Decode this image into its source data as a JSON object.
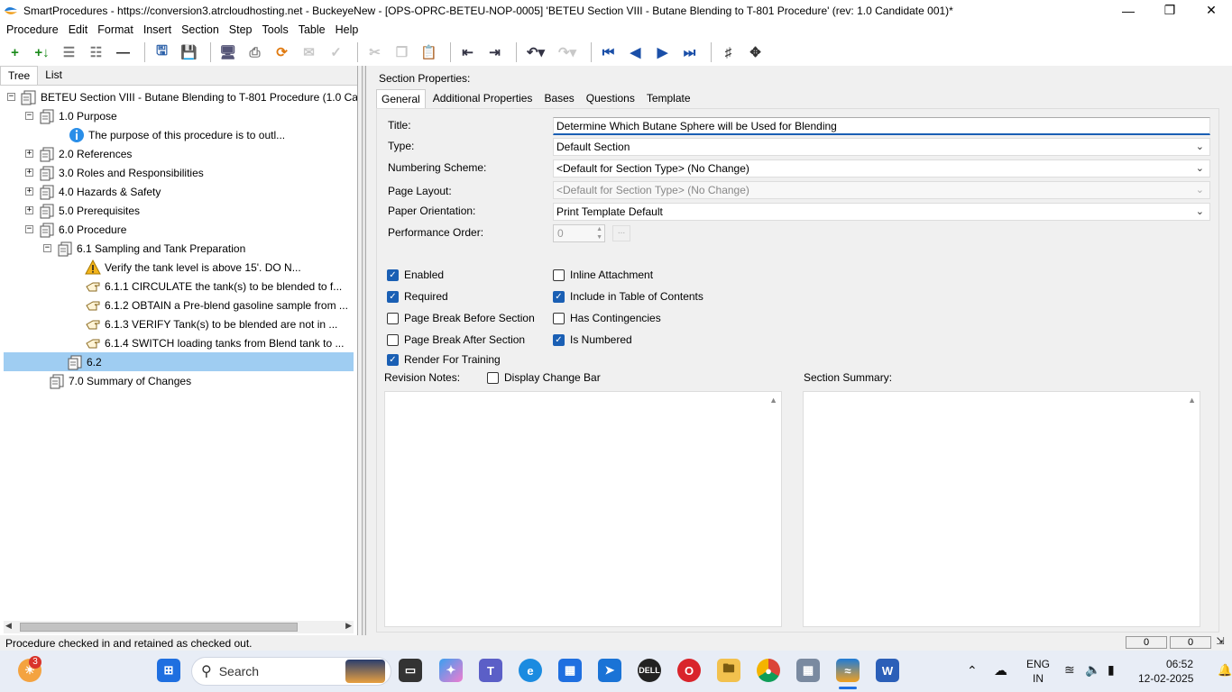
{
  "window": {
    "title": "SmartProcedures - https://conversion3.atrcloudhosting.net - BuckeyeNew - [OPS-OPRC-BETEU-NOP-0005] 'BETEU Section VIII - Butane Blending to T-801 Procedure' (rev: 1.0 Candidate 001)*",
    "minimize": "—",
    "maximize": "❐",
    "close": "✕"
  },
  "menu": [
    "Procedure",
    "Edit",
    "Format",
    "Insert",
    "Section",
    "Step",
    "Tools",
    "Table",
    "Help"
  ],
  "left_panel": {
    "tabs": [
      "Tree",
      "List"
    ],
    "tree": [
      {
        "label": "BETEU Section VIII - Butane Blending to T-801 Procedure (1.0 Ca...",
        "expander": "−",
        "icon": "procedure-icon"
      },
      {
        "label": "1.0 Purpose",
        "expander": "−",
        "icon": "section-icon"
      },
      {
        "label": "The purpose of this procedure is to outl...",
        "expander": "",
        "icon": "info-icon"
      },
      {
        "label": "2.0 References",
        "expander": "+",
        "icon": "section-icon"
      },
      {
        "label": "3.0 Roles and Responsibilities",
        "expander": "+",
        "icon": "section-icon"
      },
      {
        "label": "4.0 Hazards & Safety",
        "expander": "+",
        "icon": "section-icon"
      },
      {
        "label": "5.0 Prerequisites",
        "expander": "+",
        "icon": "section-icon"
      },
      {
        "label": "6.0 Procedure",
        "expander": "−",
        "icon": "section-icon"
      },
      {
        "label": "6.1 Sampling and Tank Preparation",
        "expander": "−",
        "icon": "section-icon"
      },
      {
        "label": "Verify the tank level is above 15'. DO N...",
        "expander": "",
        "icon": "warning-icon"
      },
      {
        "label": "6.1.1 CIRCULATE the tank(s) to be blended to f...",
        "expander": "",
        "icon": "step-hand-icon"
      },
      {
        "label": "6.1.2 OBTAIN a Pre-blend gasoline sample from ...",
        "expander": "",
        "icon": "step-hand-icon"
      },
      {
        "label": "6.1.3 VERIFY Tank(s) to be blended are not in ...",
        "expander": "",
        "icon": "step-hand-icon"
      },
      {
        "label": "6.1.4 SWITCH loading tanks from Blend tank to ...",
        "expander": "",
        "icon": "step-hand-icon"
      },
      {
        "label": "6.2",
        "expander": "",
        "icon": "section-icon",
        "selected": true
      },
      {
        "label": "7.0 Summary of Changes",
        "expander": "",
        "icon": "section-icon"
      }
    ]
  },
  "right_panel": {
    "header": "Section Properties:",
    "tabs": [
      "General",
      "Additional Properties",
      "Bases",
      "Questions",
      "Template"
    ],
    "labels": {
      "title": "Title:",
      "type": "Type:",
      "numbering": "Numbering Scheme:",
      "page_layout": "Page Layout:",
      "orientation": "Paper Orientation:",
      "perf_order": "Performance Order:",
      "revision_notes": "Revision Notes:",
      "section_summary": "Section Summary:"
    },
    "values": {
      "title": "Determine Which Butane Sphere will be Used for Blending",
      "type": "Default Section",
      "numbering": "<Default for Section Type> (No Change)",
      "page_layout": "<Default for Section Type> (No Change)",
      "orientation": "Print Template Default",
      "perf_order": "0",
      "perf_button": "..."
    },
    "checkboxes": {
      "enabled": {
        "label": "Enabled",
        "checked": true
      },
      "required": {
        "label": "Required",
        "checked": true
      },
      "page_break_before": {
        "label": "Page Break Before Section",
        "checked": false
      },
      "page_break_after": {
        "label": "Page Break After Section",
        "checked": false
      },
      "render_training": {
        "label": "Render For Training",
        "checked": true
      },
      "inline_attachment": {
        "label": "Inline Attachment",
        "checked": false
      },
      "include_toc": {
        "label": "Include in Table of Contents",
        "checked": true
      },
      "has_contingencies": {
        "label": "Has Contingencies",
        "checked": false
      },
      "is_numbered": {
        "label": "Is Numbered",
        "checked": true
      },
      "display_change_bar": {
        "label": "Display Change Bar",
        "checked": false
      }
    }
  },
  "status": {
    "text": "Procedure checked in and retained as checked out.",
    "panel1": "0",
    "panel2": "0"
  },
  "taskbar": {
    "search_placeholder": "Search",
    "weather_badge": "3",
    "lang_line1": "ENG",
    "lang_line2": "IN",
    "time": "06:52",
    "date": "12-02-2025"
  },
  "colors": {
    "selection": "#9fcdf2",
    "accent": "#1a5fb4",
    "taskbar": "#e8edf6"
  }
}
